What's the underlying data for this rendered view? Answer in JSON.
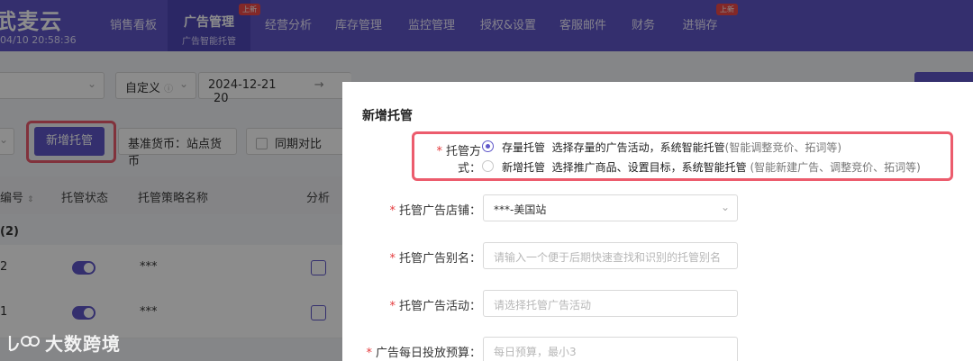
{
  "brand": {
    "name": "武麦云",
    "time": "04/10 20:58:36"
  },
  "nav": {
    "items": [
      {
        "label": "销售看板"
      },
      {
        "label": "广告管理",
        "sub": "广告智能托管",
        "badge": "上新"
      },
      {
        "label": "经营分析"
      },
      {
        "label": "库存管理"
      },
      {
        "label": "监控管理"
      },
      {
        "label": "授权&设置"
      },
      {
        "label": "客服邮件"
      },
      {
        "label": "财务"
      },
      {
        "label": "进销存",
        "badge": "上新"
      }
    ]
  },
  "filters": {
    "date_mode": "自定义",
    "date_start": "2024-12-21",
    "date_arrow": "→",
    "date_end_partial": "20",
    "add_button": "新增托管",
    "currency": "基准货币：站点货币",
    "compare_label": "同期对比"
  },
  "table": {
    "headers": [
      "编号",
      "托管状态",
      "托管策略名称",
      "分析"
    ],
    "group_label": "(2)",
    "rows": [
      {
        "id": "2",
        "name": "***"
      },
      {
        "id": "1",
        "name": "***"
      }
    ]
  },
  "modal": {
    "title": "新增托管",
    "mode_label": "托管方式：",
    "options": [
      {
        "name": "存量托管",
        "desc": "选择存量的广告活动，系统智能托管",
        "hint": "(智能调整竞价、拓词等)",
        "selected": true
      },
      {
        "name": "新增托管",
        "desc": "选择推广商品、设置目标，系统智能托管",
        "hint": "(智能新建广告、调整竞价、拓词等)",
        "selected": false
      }
    ],
    "store_label": "托管广告店铺：",
    "store_value": "***-美国站",
    "alias_label": "托管广告别名：",
    "alias_placeholder": "请输入一个便于后期快速查找和识别的托管别名",
    "campaign_label": "托管广告活动：",
    "campaign_placeholder": "请选择托管广告活动",
    "budget_label": "广告每日投放预算：",
    "budget_placeholder": "每日预算，最小3"
  },
  "watermark": "大数跨境",
  "colors": {
    "primary": "#5f57c9",
    "highlight": "#ec5c6d",
    "required": "#e4393c"
  }
}
